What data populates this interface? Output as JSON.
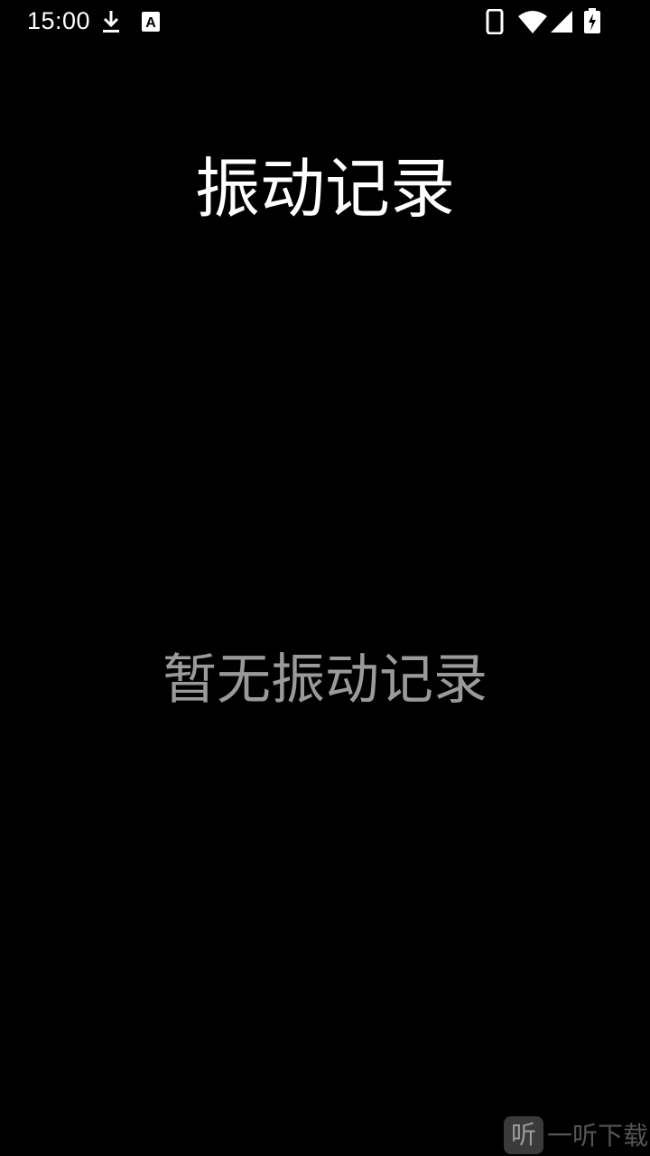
{
  "status_bar": {
    "time": "15:00",
    "icons": [
      "download-icon",
      "a-badge-icon",
      "phone-icon",
      "wifi-icon",
      "signal-icon",
      "battery-charging-icon"
    ]
  },
  "page": {
    "title": "振动记录",
    "empty_message": "暂无振动记录"
  },
  "watermark": {
    "logo": "听",
    "text": "一听下载"
  },
  "colors": {
    "background": "#000000",
    "title": "#ffffff",
    "empty_text": "#9a9a9a"
  }
}
